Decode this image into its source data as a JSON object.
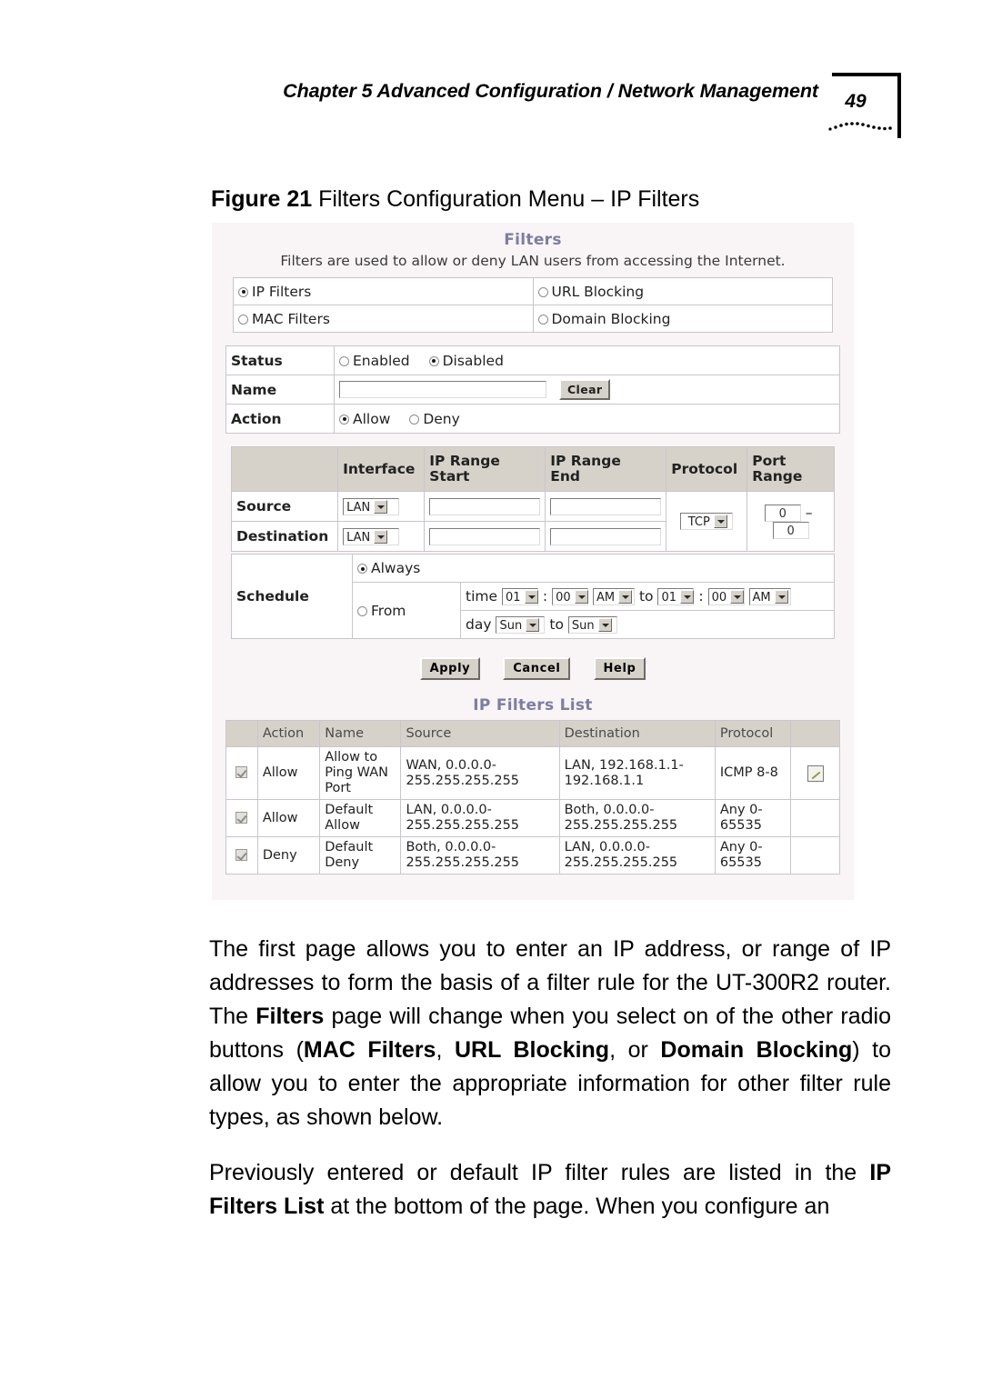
{
  "header": {
    "title": "Chapter 5 Advanced Configuration / Network Management",
    "page_number": "49"
  },
  "figure": {
    "label": "Figure 21",
    "caption": " Filters Configuration Menu – IP Filters"
  },
  "screenshot": {
    "panel_title": "Filters",
    "panel_description": "Filters are used to allow or deny LAN users from accessing the Internet.",
    "filter_types": [
      {
        "label": "IP Filters",
        "selected": true
      },
      {
        "label": "URL Blocking",
        "selected": false
      },
      {
        "label": "MAC Filters",
        "selected": false
      },
      {
        "label": "Domain Blocking",
        "selected": false
      }
    ],
    "status": {
      "label": "Status",
      "enabled_label": "Enabled",
      "disabled_label": "Disabled"
    },
    "name": {
      "label": "Name",
      "value": "",
      "placeholder": "",
      "clear_button": "Clear"
    },
    "action": {
      "label": "Action",
      "allow_label": "Allow",
      "deny_label": "Deny"
    },
    "sd_table": {
      "headers": [
        "",
        "Interface",
        "IP Range Start",
        "IP Range End",
        "Protocol",
        "Port Range"
      ],
      "header_interface": "Interface",
      "header_ip_start_1": "IP Range",
      "header_ip_start_2": "Start",
      "header_ip_end_1": "IP Range",
      "header_ip_end_2": "End",
      "header_protocol": "Protocol",
      "header_port_1": "Port",
      "header_port_2": "Range",
      "source_label": "Source",
      "destination_label": "Destination",
      "source_interface": "LAN",
      "destination_interface": "LAN",
      "source_ip_start": "",
      "source_ip_end": "",
      "destination_ip_start": "",
      "destination_ip_end": "",
      "protocol": "TCP",
      "port_start": "0",
      "port_end": "0",
      "port_separator": "–"
    },
    "schedule": {
      "label": "Schedule",
      "always_label": "Always",
      "from_label": "From",
      "time_label": "time",
      "day_label": "day",
      "to_label": "to",
      "colon": ":",
      "start_hour": "01",
      "start_minute": "00",
      "start_ampm": "AM",
      "end_hour": "01",
      "end_minute": "00",
      "end_ampm": "AM",
      "start_day": "Sun",
      "end_day": "Sun"
    },
    "buttons": {
      "apply": "Apply",
      "cancel": "Cancel",
      "help": "Help"
    },
    "list": {
      "title": "IP Filters List",
      "headers": [
        "",
        "Action",
        "Name",
        "Source",
        "Destination",
        "Protocol",
        ""
      ],
      "rows": [
        {
          "checked": true,
          "action": "Allow",
          "name": "Allow to Ping WAN Port",
          "source": "WAN, 0.0.0.0-255.255.255.255",
          "destination": "LAN, 192.168.1.1-192.168.1.1",
          "protocol": "ICMP  8-8",
          "has_edit": true
        },
        {
          "checked": true,
          "action": "Allow",
          "name": "Default Allow",
          "source": "LAN, 0.0.0.0-255.255.255.255",
          "destination": "Both, 0.0.0.0-255.255.255.255",
          "protocol": "Any  0-65535",
          "has_edit": false
        },
        {
          "checked": true,
          "action": "Deny",
          "name": "Default Deny",
          "source": "Both, 0.0.0.0-255.255.255.255",
          "destination": "LAN, 0.0.0.0-255.255.255.255",
          "protocol": "Any  0-65535",
          "has_edit": false
        }
      ]
    }
  },
  "body": {
    "paragraph1_part1": "The first page allows you to enter an IP address, or range of IP addresses to form the basis of a filter rule for the UT-300R2 router. The ",
    "paragraph1_bold1": "Filters",
    "paragraph1_part2": " page will change when you select on of the other radio buttons (",
    "paragraph1_bold2": "MAC Filters",
    "paragraph1_part3": ", ",
    "paragraph1_bold3": "URL Blocking",
    "paragraph1_part4": ", or ",
    "paragraph1_bold4": "Domain Blocking",
    "paragraph1_part5": ") to allow you to enter the appropriate information for other filter rule types, as shown below.",
    "paragraph2_part1": "Previously entered or default IP filter rules are listed in the ",
    "paragraph2_bold1": "IP Filters List",
    "paragraph2_part2": " at the bottom of the page. When you configure an"
  },
  "colors": {
    "panel_background": "#f9f4f5",
    "panel_title": "#7d7da3",
    "table_header": "#d6d2ca",
    "button_face": "#d6d2ca"
  }
}
